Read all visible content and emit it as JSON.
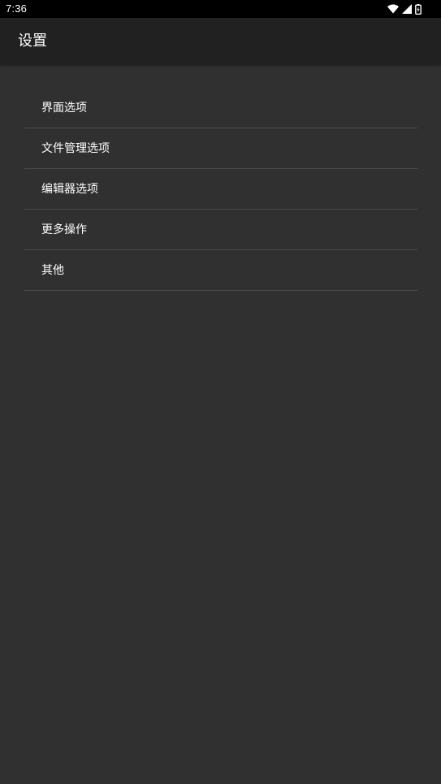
{
  "status_bar": {
    "time": "7:36",
    "icons": [
      "wifi-icon",
      "cell-signal-icon",
      "battery-charging-icon"
    ]
  },
  "app_bar": {
    "title": "设置"
  },
  "settings": {
    "items": [
      {
        "label": "界面选项"
      },
      {
        "label": "文件管理选项"
      },
      {
        "label": "编辑器选项"
      },
      {
        "label": "更多操作"
      },
      {
        "label": "其他"
      }
    ]
  },
  "colors": {
    "background": "#303030",
    "app_bar": "#212121",
    "status_bar": "#000000",
    "divider": "#4a4a4a",
    "text": "#ffffff"
  }
}
